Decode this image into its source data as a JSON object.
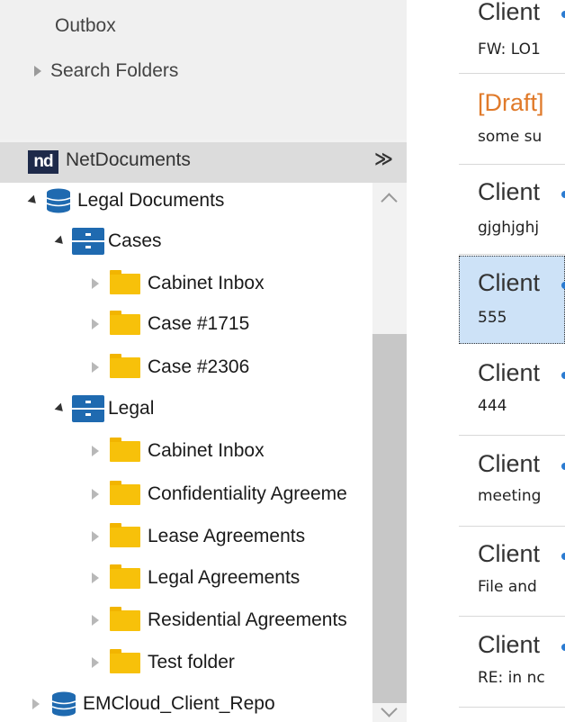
{
  "nav": {
    "outbox": "Outbox",
    "search_folders": "Search Folders"
  },
  "netdocuments": {
    "logo_text": "nd",
    "title": "NetDocuments",
    "collapse_glyph": "»"
  },
  "tree": {
    "repositories": [
      {
        "label": "Legal Documents",
        "cabinets": [
          {
            "label": "Cases",
            "folders": [
              "Cabinet Inbox",
              "Case #1715",
              "Case #2306"
            ]
          },
          {
            "label": "Legal",
            "folders": [
              "Cabinet Inbox",
              "Confidentiality Agreeme",
              "Lease Agreements",
              "Legal Agreements",
              "Residential Agreements",
              "Test folder"
            ]
          }
        ]
      },
      {
        "label": "EMCloud_Client_Repo"
      }
    ]
  },
  "mail_list": [
    {
      "sender": "Client",
      "subject": "FW: LO1",
      "state": "normal"
    },
    {
      "sender": "[Draft]",
      "subject": "some su",
      "state": "draft"
    },
    {
      "sender": "Client",
      "subject": "gjghjghj",
      "state": "normal"
    },
    {
      "sender": "Client",
      "subject": "555",
      "state": "selected"
    },
    {
      "sender": "Client",
      "subject": "444",
      "state": "normal"
    },
    {
      "sender": "Client",
      "subject": "meeting",
      "state": "normal"
    },
    {
      "sender": "Client",
      "subject": "File and",
      "state": "normal"
    },
    {
      "sender": "Client",
      "subject": "RE: in nc",
      "state": "normal"
    }
  ],
  "colors": {
    "selected_bg": "#cde2f7",
    "draft_text": "#e07a2a",
    "folder": "#f7c10a",
    "cabinet": "#1f6ab0",
    "nd_logo_bg": "#1e2a4a"
  },
  "icons": [
    "triangle-right-icon",
    "triangle-expanded-icon",
    "database-icon",
    "cabinet-icon",
    "folder-icon",
    "double-chevron-down-icon"
  ]
}
